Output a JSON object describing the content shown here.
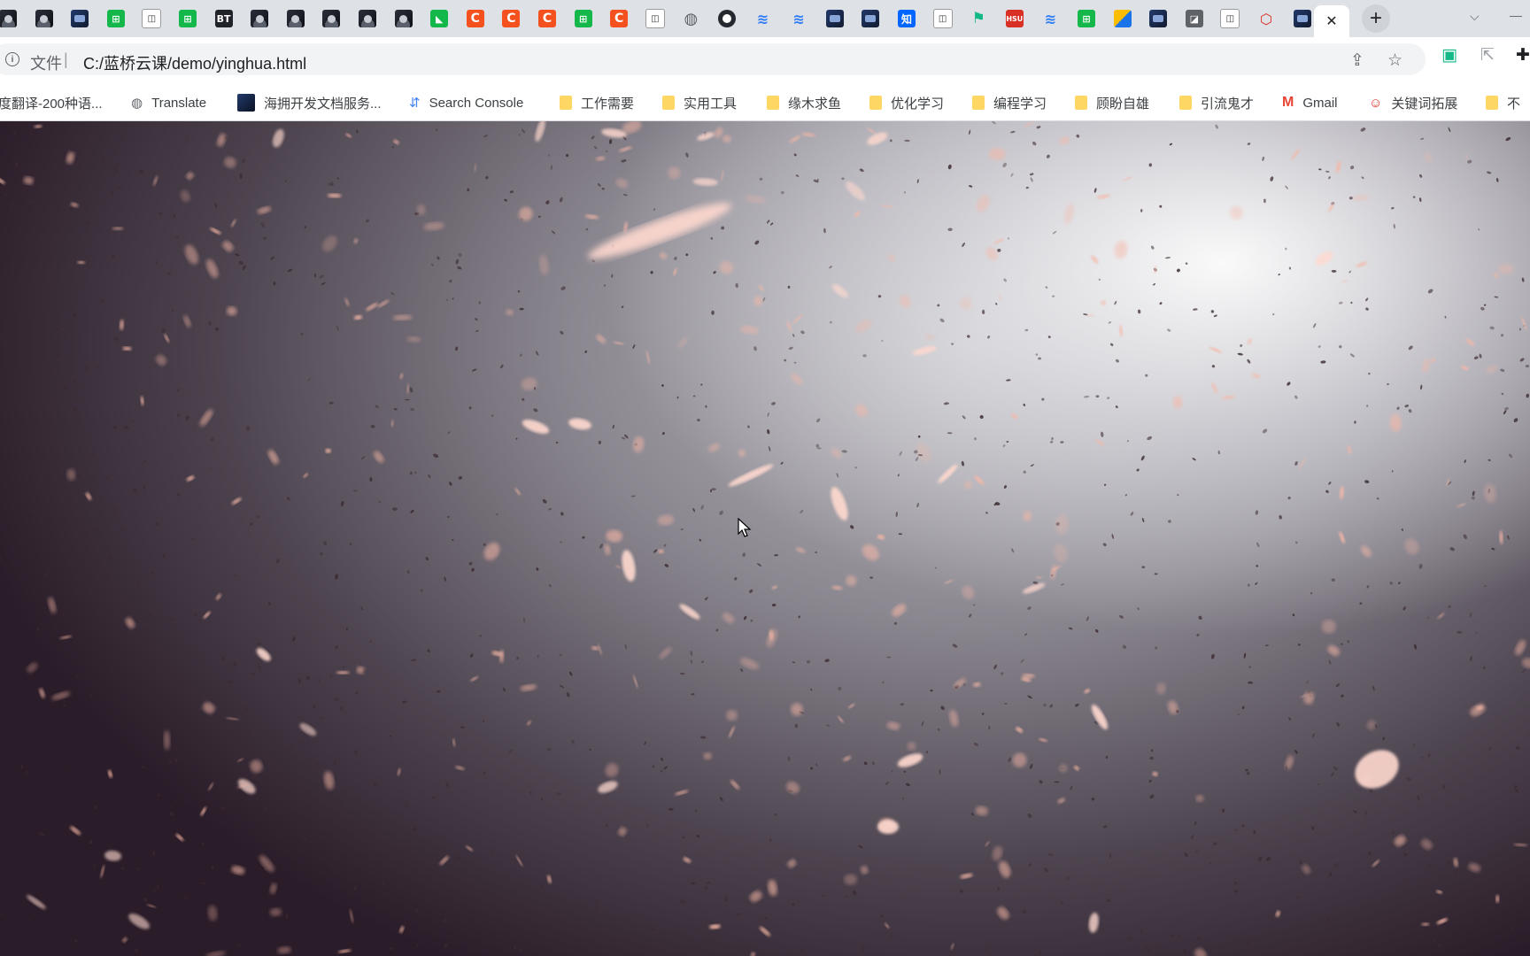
{
  "browser": {
    "tabs": [
      {
        "favicon": "dark-portrait-icon"
      },
      {
        "favicon": "dark-portrait-icon"
      },
      {
        "favicon": "navy-square-icon"
      },
      {
        "favicon": "green-sheet-icon"
      },
      {
        "favicon": "white-doc-icon"
      },
      {
        "favicon": "green-sheet-icon"
      },
      {
        "favicon": "bt-icon",
        "glyph": "BT"
      },
      {
        "favicon": "dark-portrait-icon"
      },
      {
        "favicon": "dark-portrait-icon"
      },
      {
        "favicon": "dark-portrait-icon"
      },
      {
        "favicon": "dark-portrait-icon"
      },
      {
        "favicon": "dark-portrait-icon"
      },
      {
        "favicon": "green-leaf-icon"
      },
      {
        "favicon": "orange-c-icon",
        "glyph": "C"
      },
      {
        "favicon": "orange-c-icon",
        "glyph": "C"
      },
      {
        "favicon": "orange-c-icon",
        "glyph": "C"
      },
      {
        "favicon": "green-sheet-icon"
      },
      {
        "favicon": "orange-c-icon",
        "glyph": "C"
      },
      {
        "favicon": "white-doc-icon"
      },
      {
        "favicon": "globe-icon"
      },
      {
        "favicon": "github-icon"
      },
      {
        "favicon": "blue-layers-icon"
      },
      {
        "favicon": "blue-layers-icon"
      },
      {
        "favicon": "navy-square-icon"
      },
      {
        "favicon": "navy-square-icon"
      },
      {
        "favicon": "zhihu-icon",
        "glyph": "知"
      },
      {
        "favicon": "white-doc-icon"
      },
      {
        "favicon": "green-flag-icon"
      },
      {
        "favicon": "hsu-icon",
        "glyph": "HSU"
      },
      {
        "favicon": "blue-layers-icon"
      },
      {
        "favicon": "green-sheet-icon"
      },
      {
        "favicon": "yellow-blue-icon"
      },
      {
        "favicon": "navy-square-icon"
      },
      {
        "favicon": "camera-icon"
      },
      {
        "favicon": "white-doc-icon"
      },
      {
        "favicon": "red-shield-icon"
      },
      {
        "favicon": "navy-square-icon"
      }
    ],
    "active_tab_close": "✕",
    "new_tab": "+",
    "address": {
      "scheme_label": "文件",
      "separator": "|",
      "url": "C:/蓝桥云课/demo/yinghua.html"
    },
    "bookmarks": [
      {
        "label": "度翻译-200种语...",
        "icon": "none"
      },
      {
        "label": "Translate",
        "icon": "globe-icon"
      },
      {
        "label": "海拥开发文档服务...",
        "icon": "navy-square-icon"
      },
      {
        "label": "Search Console",
        "icon": "search-console-icon"
      },
      {
        "label": "工作需要",
        "icon": "folder-icon"
      },
      {
        "label": "实用工具",
        "icon": "folder-icon"
      },
      {
        "label": "缘木求鱼",
        "icon": "folder-icon"
      },
      {
        "label": "优化学习",
        "icon": "folder-icon"
      },
      {
        "label": "编程学习",
        "icon": "folder-icon"
      },
      {
        "label": "顾盼自雄",
        "icon": "folder-icon"
      },
      {
        "label": "引流鬼才",
        "icon": "folder-icon"
      },
      {
        "label": "Gmail",
        "icon": "gmail-icon"
      },
      {
        "label": "关键词拓展",
        "icon": "face-icon"
      },
      {
        "label": "不",
        "icon": "folder-icon"
      }
    ]
  },
  "scene": {
    "description_colors": {
      "petal": "#f6b7a6",
      "petal_glow": "#ffd9cf",
      "dust": "#3a2a30"
    }
  }
}
